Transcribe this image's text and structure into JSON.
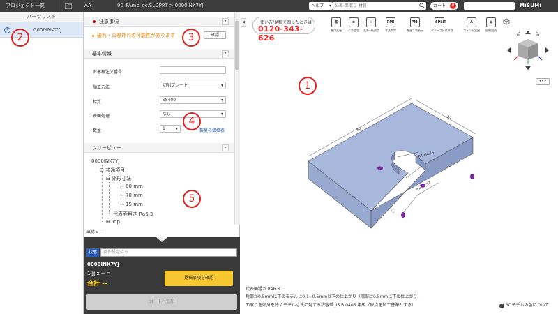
{
  "topbar": {
    "project_list": "プロジェクト一覧",
    "folder": "AA",
    "file_path": "90_FAmp_qc.SLDPRT > 0000INK7YJ",
    "help_label": "ヘルプ",
    "search_placeholder": "公差  面取り  材質",
    "cart_label": "カート",
    "cart_count": "0",
    "logo": "MiSUMi"
  },
  "left_panel": {
    "title": "パーツリスト",
    "items": [
      {
        "name": "0000INK7YJ"
      }
    ]
  },
  "caution": {
    "title": "注意事項",
    "warning": "破れ・公差外れの可能性があります",
    "confirm_label": "確認"
  },
  "basic": {
    "title": "基本情報",
    "fields": [
      {
        "label": "お客様注文番号",
        "value": ""
      },
      {
        "label": "加工方法",
        "value": "切削プレート"
      },
      {
        "label": "材質",
        "value": "SS400"
      },
      {
        "label": "表面処理",
        "value": "なし"
      },
      {
        "label": "数量",
        "value": "1"
      }
    ],
    "price_link": "数量の価格表"
  },
  "tree": {
    "title": "ツリービュー",
    "root": "0000INK7YJ",
    "common": "共通項目",
    "dims": "外形寸法",
    "x": "80 mm",
    "y": "70 mm",
    "z": "15 mm",
    "roughness": "代表面粗さ Ra6.3",
    "top": "Top"
  },
  "ship_date": "出荷日 --",
  "order": {
    "status_label": "状態",
    "status_placeholder": "条件設定待ち",
    "part_name": "0000INK7YJ",
    "qty_line": "1個 x -- =",
    "total": "合計 --",
    "confirm_button": "見積事項を確認",
    "add_cart_button": "カートへ追加"
  },
  "viewer": {
    "phone_text": "使い方/見積で困ったときは",
    "phone_number": "0120-343-626",
    "tools": [
      {
        "icon": "基",
        "label": "基点変更"
      },
      {
        "icon": "±",
        "label": "公差追加"
      },
      {
        "icon": "+",
        "label": "寸法一括追加"
      },
      {
        "icon": "PMI",
        "label": "寸法削除"
      },
      {
        "icon": "PMI",
        "label": "最適寸法表示"
      },
      {
        "icon": "SPLIT",
        "label": "グループ分け解除"
      },
      {
        "icon": "A",
        "label": "フォント変更"
      },
      {
        "icon": "▦",
        "label": "展開図割"
      }
    ],
    "menu_label": "•••",
    "surface_note": "代表面粗さ Ra6.3",
    "note1": "角部が0.5mm以下のモデルは0.1~0.5mm以下の仕上がり（隅部は0.5mm以下の仕上がり）",
    "note2": "面取りを部分を除くモデル寸法に対する許容差 JIS B 0405 中級（原点を加工基準とする）",
    "color_link": "3Dモデルの色について",
    "dim_labels": [
      "80",
      "70",
      "R4 M4.15",
      "4×M4 12"
    ]
  },
  "annotations": [
    "1",
    "2",
    "3",
    "4",
    "5"
  ],
  "colors": {
    "accent": "#e02020",
    "model": "#a7b8dc",
    "dark": "#3a3a3a",
    "button": "#f7c731"
  }
}
